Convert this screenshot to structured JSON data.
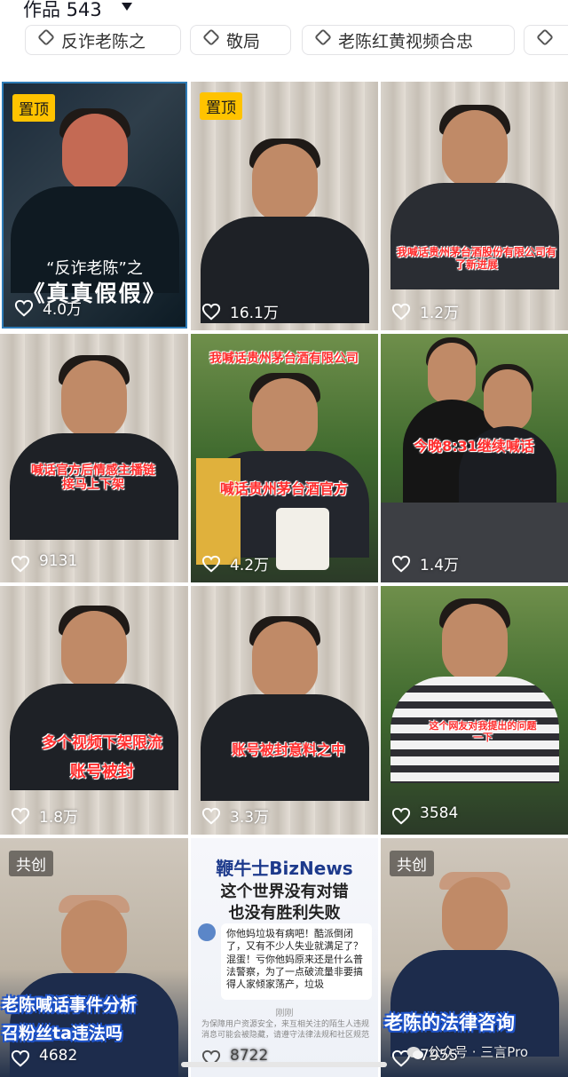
{
  "header": {
    "title": "作品 543"
  },
  "chips": [
    "反诈老陈之",
    "敬局",
    "老陈红黄视频合忠"
  ],
  "videos": [
    {
      "pinned": "置顶",
      "caption_top": "“反诈老陈”之",
      "caption_main": "《真真假假》",
      "likes": "4.0万"
    },
    {
      "pinned": "置顶",
      "likes": "16.1万"
    },
    {
      "caption": "我喊话贵州茅台酒股份有限公司有了新进展",
      "likes": "1.2万"
    },
    {
      "caption": "喊话官方后情感主播链接马上下架",
      "likes": "9131"
    },
    {
      "caption_top": "我喊话贵州茅台酒有限公司",
      "caption_bottom": "喊话贵州茅台酒官方",
      "likes": "4.2万"
    },
    {
      "caption": "今晚8:31继续喊话",
      "likes": "1.4万"
    },
    {
      "caption_top": "多个视频下架限流",
      "caption_bottom": "账号被封",
      "likes": "1.8万"
    },
    {
      "caption": "账号被封意料之中",
      "likes": "3.3万"
    },
    {
      "caption": "这个网友对我提出的问题一下",
      "likes": "3584"
    },
    {
      "collab": "共创",
      "caption_1": "老陈喊话事件分析",
      "caption_2": "召粉丝ta违法吗",
      "likes": "4682"
    },
    {
      "brand": "鞭牛士BizNews",
      "line_1": "这个世界没有对错",
      "line_2": "也没有胜利失败",
      "card": "你他妈垃圾有病吧！酷派倒闭了，又有不少人失业就满足了？混蛋！亏你他妈原来还是什么普法警察，为了一点破流量非要搞得人家倾家荡产，垃圾",
      "foot": "刚刚",
      "note": "为保障用户资源安全，来互相关注的陌生人违规消息可能会被隐藏，请遵守法律法规和社区规范",
      "likes": "8722"
    },
    {
      "collab": "共创",
      "caption": "老陈的法律咨询",
      "likes": "7955"
    }
  ],
  "watermark": "公众号 · 三言Pro",
  "colors": {
    "pin_badge": "#ffc300",
    "caption_red": "#ff2d2d",
    "caption_outline_blue": "#1d52c9"
  }
}
